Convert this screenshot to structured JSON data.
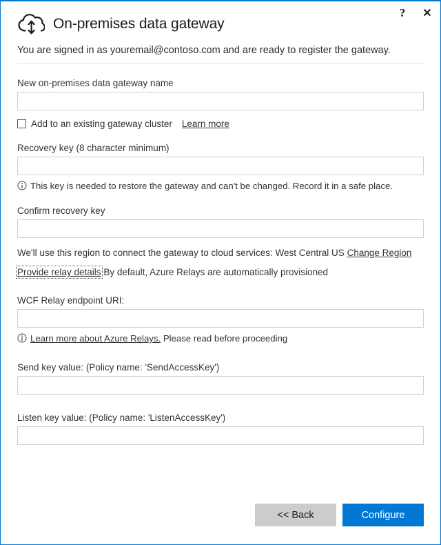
{
  "window": {
    "accent_color": "#0078d4",
    "help_glyph": "?",
    "close_glyph": "✕"
  },
  "header": {
    "icon": "cloud-upload-download-icon",
    "title": "On-premises data gateway",
    "signin_message": "You are signed in as youremail@contoso.com and are ready to register the gateway."
  },
  "form": {
    "gateway_name": {
      "label": "New on-premises data gateway name",
      "value": "",
      "placeholder": ""
    },
    "cluster_checkbox": {
      "label": "Add to an existing gateway cluster",
      "checked": false,
      "link_label": "Learn more"
    },
    "recovery_key": {
      "label": "Recovery key (8 character minimum)",
      "value": "",
      "placeholder": "",
      "note": "This key is needed to restore the gateway and can't be changed. Record it in a safe place."
    },
    "confirm_recovery_key": {
      "label": "Confirm recovery key",
      "value": "",
      "placeholder": ""
    },
    "region": {
      "text": "We'll use this region to connect the gateway to cloud services: West Central US",
      "value": "West Central US",
      "change_link": "Change Region"
    },
    "relay": {
      "toggle_link": "Provide relay details",
      "description": "By default, Azure Relays are automatically provisioned"
    },
    "wcf_relay_uri": {
      "label": "WCF Relay endpoint URI:",
      "value": "",
      "placeholder": "",
      "note_link": "Learn more about Azure Relays.",
      "note_rest": "Please read before proceeding"
    },
    "send_key": {
      "label": "Send key value: (Policy name: 'SendAccessKey')",
      "value": "",
      "placeholder": ""
    },
    "listen_key": {
      "label": "Listen key value: (Policy name: 'ListenAccessKey')",
      "value": "",
      "placeholder": ""
    }
  },
  "footer": {
    "back_label": "<< Back",
    "configure_label": "Configure"
  }
}
